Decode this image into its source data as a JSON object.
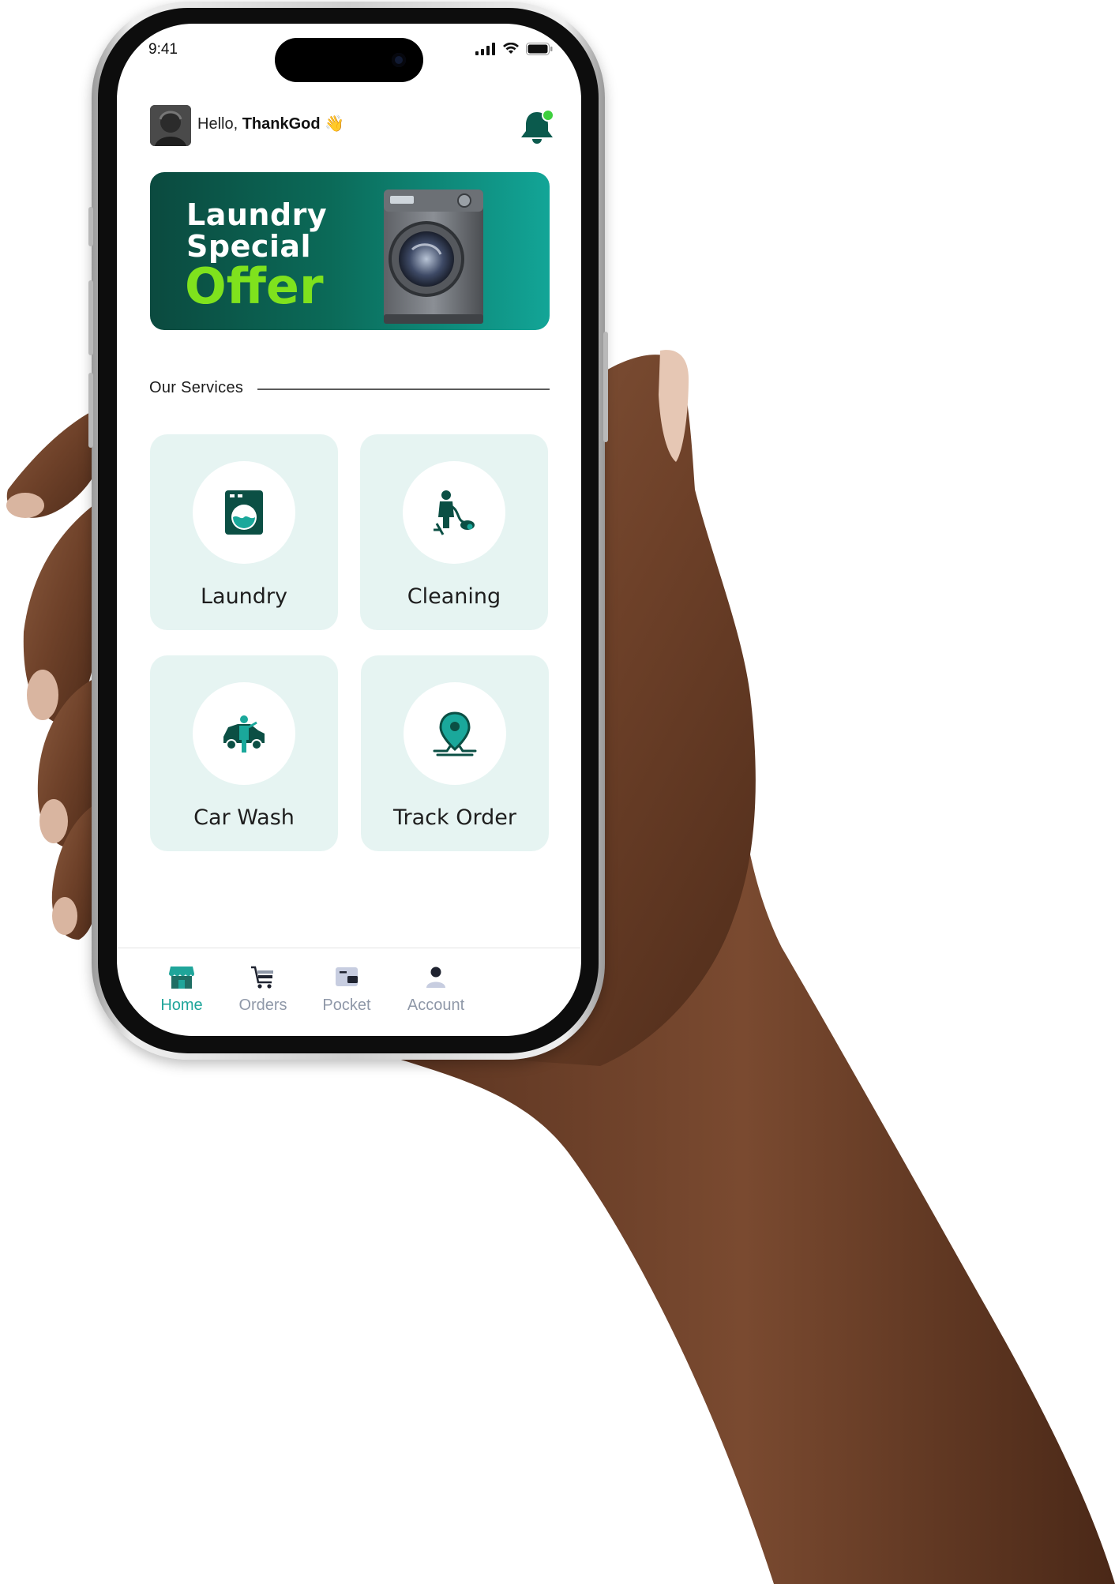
{
  "status_bar": {
    "time": "9:41"
  },
  "header": {
    "greeting_prefix": "Hello,",
    "user_name": "ThankGod",
    "wave_emoji": "👋"
  },
  "banner": {
    "line1": "Laundry",
    "line2": "Special",
    "line3": "Offer"
  },
  "services": {
    "section_title": "Our Services",
    "items": [
      {
        "label": "Laundry",
        "icon": "washing-machine-icon"
      },
      {
        "label": "Cleaning",
        "icon": "vacuum-cleaning-icon"
      },
      {
        "label": "Car Wash",
        "icon": "car-wash-icon"
      },
      {
        "label": "Track Order",
        "icon": "location-pin-icon"
      }
    ]
  },
  "bottom_nav": {
    "items": [
      {
        "label": "Home",
        "icon": "store-icon",
        "active": true
      },
      {
        "label": "Orders",
        "icon": "cart-icon",
        "active": false
      },
      {
        "label": "Pocket",
        "icon": "wallet-icon",
        "active": false
      },
      {
        "label": "Account",
        "icon": "user-icon",
        "active": false
      }
    ]
  },
  "colors": {
    "primary": "#0b5a4d",
    "accent_green": "#7fe21d",
    "teal_active": "#1fa59a",
    "card_background": "#e6f4f2",
    "nav_inactive": "#8f98a8"
  }
}
